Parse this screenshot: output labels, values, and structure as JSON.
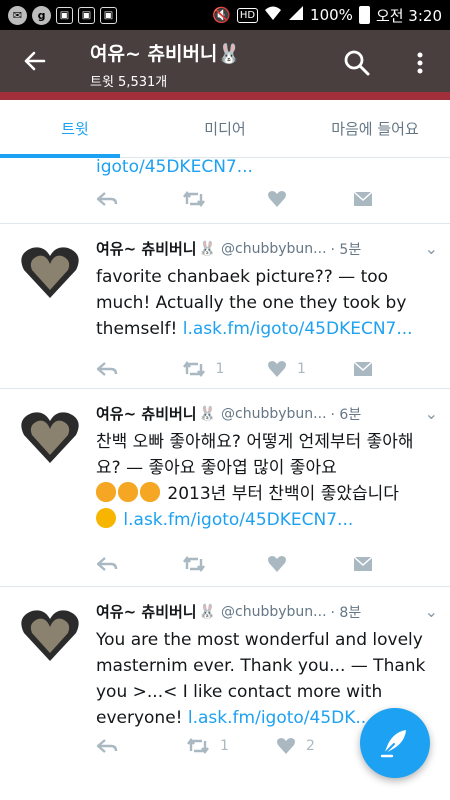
{
  "statusbar": {
    "icons": [
      "notification-icon",
      "g-app-icon",
      "app-icon-1",
      "app-icon-2",
      "app-icon-3"
    ],
    "hd": "HD",
    "battery_pct": "100%",
    "time": "오전 3:20"
  },
  "appbar": {
    "title": "여유~ 츄비버니🐰",
    "subtitle": "트윗 5,531개"
  },
  "tabs": [
    "트윗",
    "미디어",
    "마음에 들어요"
  ],
  "feed": {
    "partial_link": "igoto/45DKECN7...",
    "tweets": [
      {
        "name": "여유~ 츄비버니",
        "handle": "@chubbybun...",
        "time": "· 5분",
        "text": "favorite chanbaek picture?? — too much! Actually the one they took by themself!",
        "link": "l.ask.fm/igoto/45DKECN7...",
        "retweets": "1",
        "likes": "1"
      },
      {
        "name": "여유~ 츄비버니",
        "handle": "@chubbybun...",
        "time": "· 6분",
        "text1": "찬백 오빠 좋아해요? 어떻게 언제부터 좋아해요? — 좋아요 좋아엽 많이 좋아요",
        "text2": "2013년 부터 찬백이 좋았습니다",
        "link": "l.ask.fm/igoto/45DKECN7...",
        "retweets": "",
        "likes": ""
      },
      {
        "name": "여유~ 츄비버니",
        "handle": "@chubbybun...",
        "time": "· 8분",
        "text": "You are the most wonderful and lovely masternim ever. Thank you... — Thank you >...< I like contact more with everyone!",
        "link": "l.ask.fm/igoto/45DK...",
        "retweets": "1",
        "likes": "2"
      }
    ]
  },
  "colors": {
    "accent": "#1da1f2",
    "appbar_bg": "#4a3f3f",
    "appbar_stripe": "#a2303a"
  }
}
